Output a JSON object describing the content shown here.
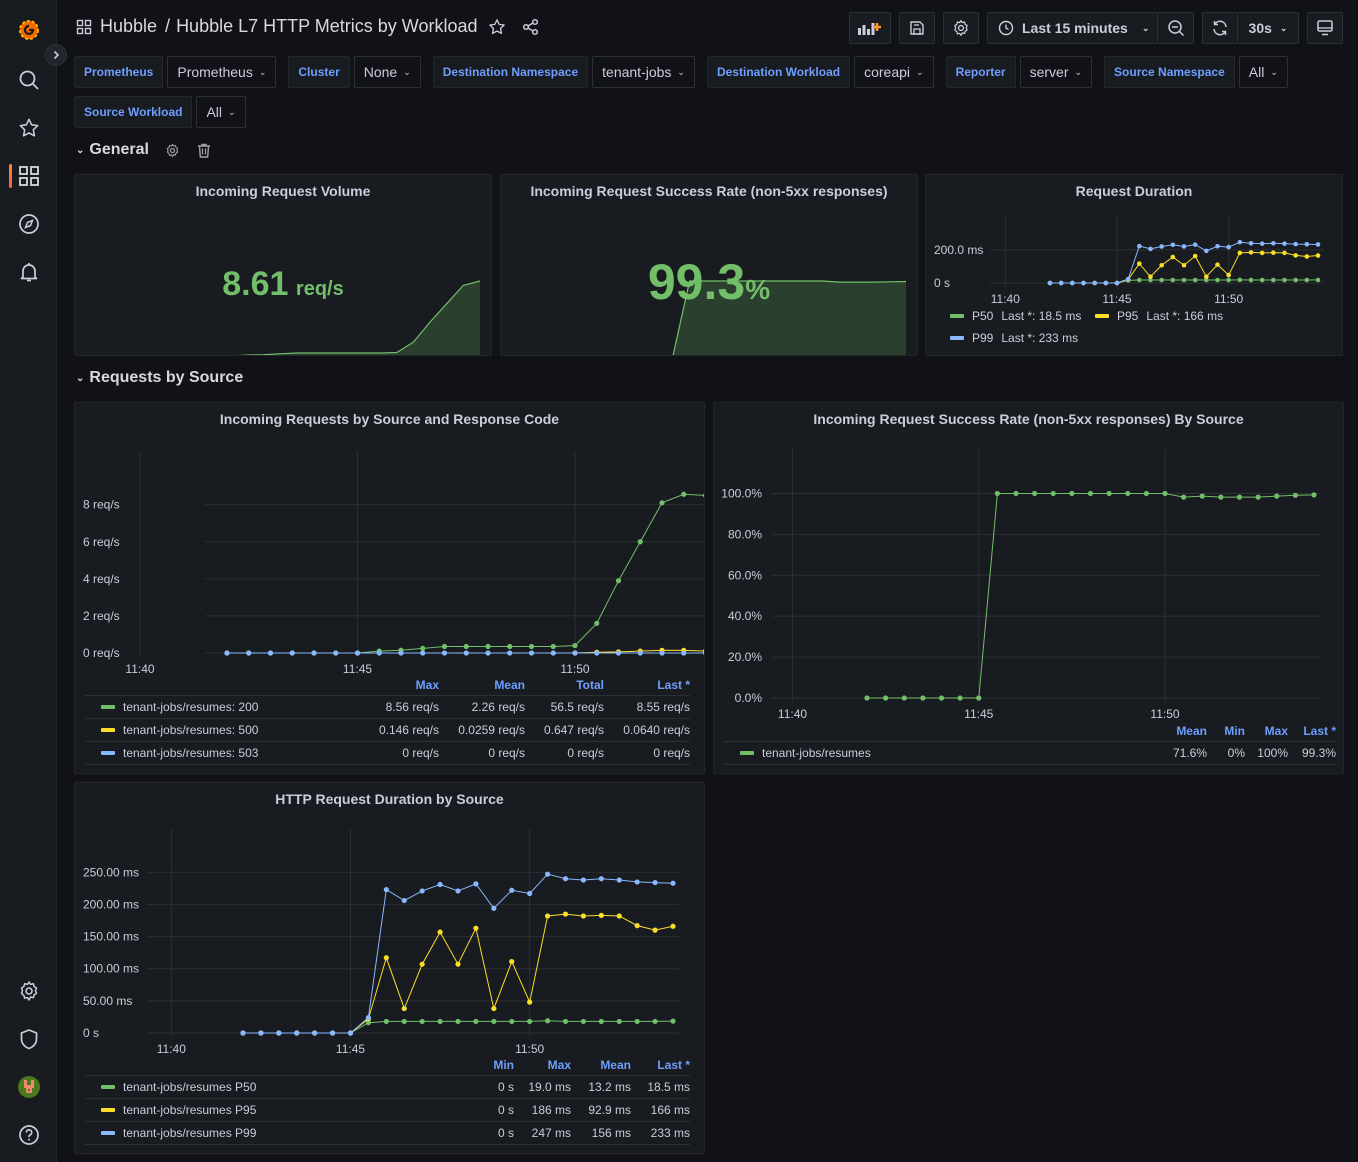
{
  "app": {
    "breadcrumb_folder": "Hubble",
    "breadcrumb_separator": "/",
    "dashboard_title": "Hubble L7 HTTP Metrics by Workload",
    "time_range": "Last 15 minutes",
    "refresh_interval": "30s"
  },
  "icons": {
    "logo": "grafana-logo-icon",
    "search": "search-icon",
    "starred": "star-icon",
    "dashboards": "dashboards-grid-icon",
    "explore": "compass-icon",
    "alerting": "bell-icon",
    "configuration": "gear-icon",
    "admin": "shield-icon",
    "profile": "avatar",
    "help": "help-icon"
  },
  "variables": [
    {
      "label": "Prometheus",
      "value": "Prometheus"
    },
    {
      "label": "Cluster",
      "value": "None"
    },
    {
      "label": "Destination Namespace",
      "value": "tenant-jobs"
    },
    {
      "label": "Destination Workload",
      "value": "coreapi"
    },
    {
      "label": "Reporter",
      "value": "server"
    },
    {
      "label": "Source Namespace",
      "value": "All"
    },
    {
      "label": "Source Workload",
      "value": "All"
    }
  ],
  "rows": [
    {
      "title": "General"
    },
    {
      "title": "Requests by Source"
    }
  ],
  "colors": {
    "green": "#73bf69",
    "yellow": "#fade2a",
    "blue": "#8ab8ff",
    "accent_blue": "#6e9fff",
    "panel_bg": "#181b1f",
    "page_bg": "#111217"
  },
  "panels": {
    "volume": {
      "title": "Incoming Request Volume",
      "value": "8.61",
      "unit": "req/s"
    },
    "success": {
      "title": "Incoming Request Success Rate (non-5xx responses)",
      "value": "99.3",
      "unit": "%"
    },
    "duration": {
      "title": "Request Duration",
      "legend": [
        {
          "name": "P50",
          "stat": "Last *: 18.5 ms"
        },
        {
          "name": "P95",
          "stat": "Last *: 166 ms"
        },
        {
          "name": "P99",
          "stat": "Last *: 233 ms"
        }
      ]
    },
    "requests_by_source": {
      "title": "Incoming Requests by Source and Response Code",
      "columns": [
        "Max",
        "Mean",
        "Total",
        "Last *"
      ],
      "rows": [
        {
          "name": "tenant-jobs/resumes: 200",
          "values": [
            "8.56 req/s",
            "2.26 req/s",
            "56.5 req/s",
            "8.55 req/s"
          ]
        },
        {
          "name": "tenant-jobs/resumes: 500",
          "values": [
            "0.146 req/s",
            "0.0259 req/s",
            "0.647 req/s",
            "0.0640 req/s"
          ]
        },
        {
          "name": "tenant-jobs/resumes: 503",
          "values": [
            "0 req/s",
            "0 req/s",
            "0 req/s",
            "0 req/s"
          ]
        }
      ]
    },
    "success_by_source": {
      "title": "Incoming Request Success Rate (non-5xx responses) By Source",
      "columns": [
        "Mean",
        "Min",
        "Max",
        "Last *"
      ],
      "rows": [
        {
          "name": "tenant-jobs/resumes",
          "values": [
            "71.6%",
            "0%",
            "100%",
            "99.3%"
          ]
        }
      ]
    },
    "duration_by_source": {
      "title": "HTTP Request Duration by Source",
      "columns": [
        "Min",
        "Max",
        "Mean",
        "Last *"
      ],
      "rows": [
        {
          "name": "tenant-jobs/resumes P50",
          "values": [
            "0 s",
            "19.0 ms",
            "13.2 ms",
            "18.5 ms"
          ]
        },
        {
          "name": "tenant-jobs/resumes P95",
          "values": [
            "0 s",
            "186 ms",
            "92.9 ms",
            "166 ms"
          ]
        },
        {
          "name": "tenant-jobs/resumes P99",
          "values": [
            "0 s",
            "247 ms",
            "156 ms",
            "233 ms"
          ]
        }
      ]
    }
  },
  "chart_data": [
    {
      "id": "volume_sparkline",
      "type": "area",
      "title": "Incoming Request Volume",
      "x": [
        0,
        1,
        2,
        3,
        4,
        5,
        6,
        7,
        8,
        9,
        10,
        11,
        12,
        13,
        14,
        15,
        16,
        17,
        18,
        19,
        20
      ],
      "series": [
        {
          "name": "volume",
          "values": [
            0,
            0,
            0,
            0,
            0,
            0,
            0.1,
            0.15,
            0.25,
            0.35,
            0.35,
            0.35,
            0.35,
            0.35,
            0.35,
            0.4,
            1.6,
            3.9,
            6.0,
            8.1,
            8.61
          ]
        }
      ]
    },
    {
      "id": "success_sparkline",
      "type": "area",
      "title": "Incoming Request Success Rate (non-5xx responses)",
      "x": [
        0,
        1,
        2,
        3,
        4,
        5,
        6,
        7,
        8,
        9,
        10,
        11,
        12,
        13,
        14,
        15,
        16,
        17,
        18,
        19,
        20
      ],
      "series": [
        {
          "name": "success",
          "values": [
            0,
            0,
            0,
            0,
            0,
            0,
            0,
            100,
            100,
            100,
            100,
            100,
            100,
            100,
            100,
            100,
            98.5,
            98.5,
            98.5,
            99,
            99.3
          ]
        }
      ]
    },
    {
      "id": "request_duration",
      "type": "line",
      "title": "Request Duration",
      "x": [
        "11:42",
        "11:42:30",
        "11:43",
        "11:43:30",
        "11:44",
        "11:44:30",
        "11:45",
        "11:45:30",
        "11:46",
        "11:46:30",
        "11:47",
        "11:47:30",
        "11:48",
        "11:48:30",
        "11:49",
        "11:49:30",
        "11:50",
        "11:50:30",
        "11:51",
        "11:51:30",
        "11:52",
        "11:52:30",
        "11:53",
        "11:53:30",
        "11:54"
      ],
      "xticks": [
        "11:40",
        "11:45",
        "11:50"
      ],
      "yticks": [
        "0 s",
        "200.0 ms"
      ],
      "ylim": [
        0,
        260
      ],
      "series": [
        {
          "name": "P50",
          "color": "#73bf69",
          "values": [
            0,
            0,
            0,
            0,
            0,
            0,
            0,
            16,
            18,
            18,
            18,
            18,
            18,
            18,
            18,
            18,
            18,
            19,
            18,
            18,
            18,
            18,
            18,
            18,
            18.5
          ]
        },
        {
          "name": "P95",
          "color": "#fade2a",
          "values": [
            0,
            0,
            0,
            0,
            0,
            0,
            0,
            22,
            117,
            38,
            107,
            157,
            107,
            163,
            38,
            111,
            48,
            182,
            185,
            182,
            183,
            182,
            167,
            160,
            166
          ]
        },
        {
          "name": "P99",
          "color": "#8ab8ff",
          "values": [
            0,
            0,
            0,
            0,
            0,
            0,
            0,
            24,
            223,
            206,
            221,
            231,
            221,
            232,
            194,
            222,
            217,
            247,
            240,
            238,
            240,
            238,
            235,
            234,
            233
          ]
        }
      ]
    },
    {
      "id": "requests_by_source",
      "type": "line",
      "title": "Incoming Requests by Source and Response Code",
      "x": [
        "11:42",
        "11:42:30",
        "11:43",
        "11:43:30",
        "11:44",
        "11:44:30",
        "11:45",
        "11:45:30",
        "11:46",
        "11:46:30",
        "11:47",
        "11:47:30",
        "11:48",
        "11:48:30",
        "11:49",
        "11:49:30",
        "11:50",
        "11:50:30",
        "11:51",
        "11:51:30",
        "11:52",
        "11:52:30",
        "11:53",
        "11:53:30",
        "11:54"
      ],
      "xticks": [
        "11:40",
        "11:45",
        "11:50"
      ],
      "yticks": [
        "0 req/s",
        "2 req/s",
        "4 req/s",
        "6 req/s",
        "8 req/s"
      ],
      "ylim": [
        0,
        9.6
      ],
      "series": [
        {
          "name": "tenant-jobs/resumes: 200",
          "color": "#73bf69",
          "values": [
            0,
            0,
            0,
            0,
            0,
            0,
            0,
            0.1,
            0.15,
            0.25,
            0.35,
            0.35,
            0.35,
            0.35,
            0.35,
            0.35,
            0.4,
            1.6,
            3.9,
            6.0,
            8.1,
            8.56,
            8.5,
            8.5,
            8.55
          ]
        },
        {
          "name": "tenant-jobs/resumes: 500",
          "color": "#fade2a",
          "values": [
            null,
            null,
            null,
            null,
            null,
            null,
            null,
            null,
            null,
            null,
            null,
            null,
            null,
            null,
            null,
            null,
            0,
            0.04,
            0.06,
            0.1,
            0.146,
            0.14,
            0.1,
            0.06,
            0.064
          ]
        },
        {
          "name": "tenant-jobs/resumes: 503",
          "color": "#8ab8ff",
          "values": [
            0,
            0,
            0,
            0,
            0,
            0,
            0,
            0,
            0,
            0,
            0,
            0,
            0,
            0,
            0,
            0,
            0,
            0,
            0,
            0,
            0,
            0,
            0,
            0,
            0
          ]
        }
      ]
    },
    {
      "id": "success_by_source",
      "type": "line",
      "title": "Incoming Request Success Rate (non-5xx responses) By Source",
      "x": [
        "11:42",
        "11:42:30",
        "11:43",
        "11:43:30",
        "11:44",
        "11:44:30",
        "11:45",
        "11:45:30",
        "11:46",
        "11:46:30",
        "11:47",
        "11:47:30",
        "11:48",
        "11:48:30",
        "11:49",
        "11:49:30",
        "11:50",
        "11:50:30",
        "11:51",
        "11:51:30",
        "11:52",
        "11:52:30",
        "11:53",
        "11:53:30",
        "11:54"
      ],
      "xticks": [
        "11:40",
        "11:45",
        "11:50"
      ],
      "yticks": [
        "0.0%",
        "20.0%",
        "40.0%",
        "60.0%",
        "80.0%",
        "100.0%"
      ],
      "ylim": [
        0,
        110
      ],
      "series": [
        {
          "name": "tenant-jobs/resumes",
          "color": "#73bf69",
          "values": [
            0,
            0,
            0,
            0,
            0,
            0,
            0,
            100,
            100,
            100,
            100,
            100,
            100,
            100,
            100,
            100,
            100,
            98.2,
            98.7,
            98.2,
            98.2,
            98.2,
            98.7,
            99.1,
            99.3
          ]
        }
      ]
    },
    {
      "id": "duration_by_source",
      "type": "line",
      "title": "HTTP Request Duration by Source",
      "x": [
        "11:42",
        "11:42:30",
        "11:43",
        "11:43:30",
        "11:44",
        "11:44:30",
        "11:45",
        "11:45:30",
        "11:46",
        "11:46:30",
        "11:47",
        "11:47:30",
        "11:48",
        "11:48:30",
        "11:49",
        "11:49:30",
        "11:50",
        "11:50:30",
        "11:51",
        "11:51:30",
        "11:52",
        "11:52:30",
        "11:53",
        "11:53:30",
        "11:54"
      ],
      "xticks": [
        "11:40",
        "11:45",
        "11:50"
      ],
      "yticks": [
        "0 s",
        "50.00 ms",
        "100.00 ms",
        "150.00 ms",
        "200.00 ms",
        "250.00 ms"
      ],
      "ylim": [
        0,
        280
      ],
      "series": [
        {
          "name": "tenant-jobs/resumes P50",
          "color": "#73bf69",
          "values": [
            0,
            0,
            0,
            0,
            0,
            0,
            0,
            16,
            18,
            18,
            18,
            18,
            18,
            18,
            18,
            18,
            18,
            19,
            18,
            18,
            18,
            18,
            18,
            18,
            18.5
          ]
        },
        {
          "name": "tenant-jobs/resumes P95",
          "color": "#fade2a",
          "values": [
            0,
            0,
            0,
            0,
            0,
            0,
            0,
            22,
            117,
            38,
            107,
            157,
            107,
            163,
            38,
            111,
            48,
            182,
            185,
            182,
            183,
            182,
            167,
            160,
            166
          ]
        },
        {
          "name": "tenant-jobs/resumes P99",
          "color": "#8ab8ff",
          "values": [
            0,
            0,
            0,
            0,
            0,
            0,
            0,
            24,
            223,
            206,
            221,
            231,
            221,
            232,
            194,
            222,
            217,
            247,
            240,
            238,
            240,
            238,
            235,
            234,
            233
          ]
        }
      ]
    }
  ]
}
